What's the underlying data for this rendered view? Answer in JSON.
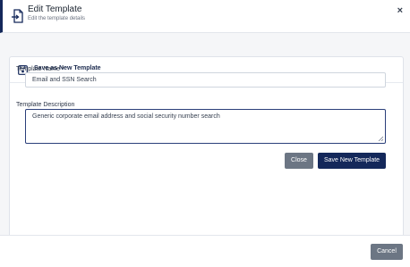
{
  "header": {
    "title": "Edit Template",
    "subtitle": "Edit the template details",
    "close_glyph": "×",
    "icon": "file-import-icon"
  },
  "card": {
    "title": "Save as New Template",
    "icon": "save-icon"
  },
  "form": {
    "name_label": "Template Name *",
    "name_value": "Email and SSN Search",
    "description_label": "Template Description",
    "description_value": "Generic corporate email address and social security number search"
  },
  "buttons": {
    "close_label": "Close",
    "save_label": "Save New Template",
    "cancel_label": "Cancel"
  },
  "colors": {
    "primary": "#14285a",
    "secondary": "#6c7684"
  }
}
